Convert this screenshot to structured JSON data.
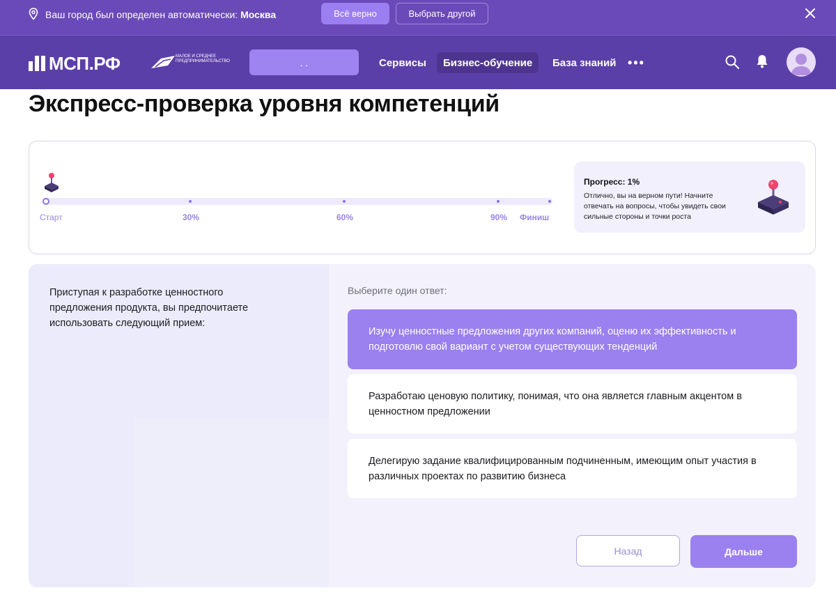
{
  "city_bar": {
    "prefix": "Ваш город был определен автоматически:",
    "city": "Москва",
    "confirm_label": "Всё верно",
    "other_label": "Выбрать другой"
  },
  "header": {
    "logo_text": "МСП.РФ",
    "logo2_text": "Малое и среднее предпринимательство",
    "search_value": ". .",
    "nav": {
      "services": "Сервисы",
      "business": "Бизнес-обучение",
      "knowledge": "База знаний",
      "more": "•••"
    }
  },
  "page": {
    "title": "Экспресс-проверка уровня компетенций"
  },
  "progress": {
    "value": 0.01,
    "title": "Прогресс: 1%",
    "text": "Отлично, вы на верном пути! Начните отвечать на вопросы, чтобы увидеть свои сильные стороны и точки роста",
    "labels": {
      "start": "Старт",
      "p30": "30%",
      "p60": "60%",
      "p90": "90%",
      "finish": "Финиш"
    }
  },
  "question": {
    "text": "Приступая к разработке ценностного предложения продукта, вы предпочитаете использовать следующий прием:",
    "prompt": "Выберите один ответ:",
    "answers": [
      "Изучу ценностные предложения других компаний, оценю их эффективность и подготовлю свой вариант с учетом существующих тенденций",
      "Разработаю ценовую политику, понимая, что она является главным акцентом в ценностном предложении",
      "Делегирую задание квалифицированным подчиненным, имеющим опыт участия в различных проектах по развитию бизнеса"
    ],
    "selected_index": 0,
    "back_label": "Назад",
    "next_label": "Дальше"
  },
  "colors": {
    "city_bar_bg": "#6a49b8",
    "header_bg": "#5b3fa8",
    "accent": "#9b80ef",
    "joystick_ball": "#f2426d"
  }
}
